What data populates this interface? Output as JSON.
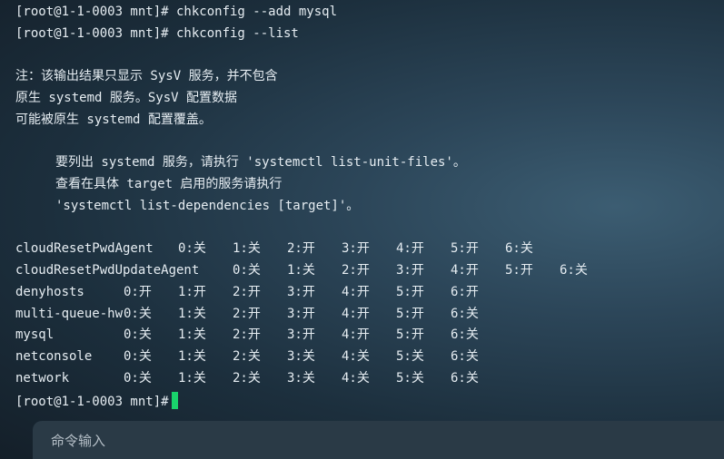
{
  "terminal": {
    "commands": [
      "[root@1-1-0003 mnt]# chkconfig --add mysql",
      "[root@1-1-0003 mnt]# chkconfig --list"
    ],
    "note": [
      "注：该输出结果只显示 SysV 服务，并不包含",
      "原生 systemd 服务。SysV 配置数据",
      "可能被原生 systemd 配置覆盖。"
    ],
    "hint": [
      "要列出 systemd 服务，请执行 'systemctl list-unit-files'。",
      "查看在具体 target 启用的服务请执行",
      "'systemctl list-dependencies [target]'。"
    ],
    "services": [
      {
        "name": "cloudResetPwdAgent",
        "levels": [
          "0:关",
          "1:关",
          "2:开",
          "3:开",
          "4:开",
          "5:开",
          "6:关"
        ]
      },
      {
        "name": "cloudResetPwdUpdateAgent",
        "levels": [
          "0:关",
          "1:关",
          "2:开",
          "3:开",
          "4:开",
          "5:开",
          "6:关"
        ]
      },
      {
        "name": "denyhosts",
        "levels": [
          "0:开",
          "1:开",
          "2:开",
          "3:开",
          "4:开",
          "5:开",
          "6:开"
        ]
      },
      {
        "name": "multi-queue-hw",
        "levels": [
          "0:关",
          "1:关",
          "2:开",
          "3:开",
          "4:开",
          "5:开",
          "6:关"
        ]
      },
      {
        "name": "mysql",
        "levels": [
          "0:关",
          "1:关",
          "2:开",
          "3:开",
          "4:开",
          "5:开",
          "6:关"
        ]
      },
      {
        "name": "netconsole",
        "levels": [
          "0:关",
          "1:关",
          "2:关",
          "3:关",
          "4:关",
          "5:关",
          "6:关"
        ]
      },
      {
        "name": "network",
        "levels": [
          "0:关",
          "1:关",
          "2:关",
          "3:关",
          "4:关",
          "5:关",
          "6:关"
        ]
      }
    ],
    "prompt": "[root@1-1-0003 mnt]#"
  },
  "command_input": {
    "placeholder": "命令输入"
  },
  "colors": {
    "cursor": "#19d36b",
    "text": "#e6edf2"
  }
}
